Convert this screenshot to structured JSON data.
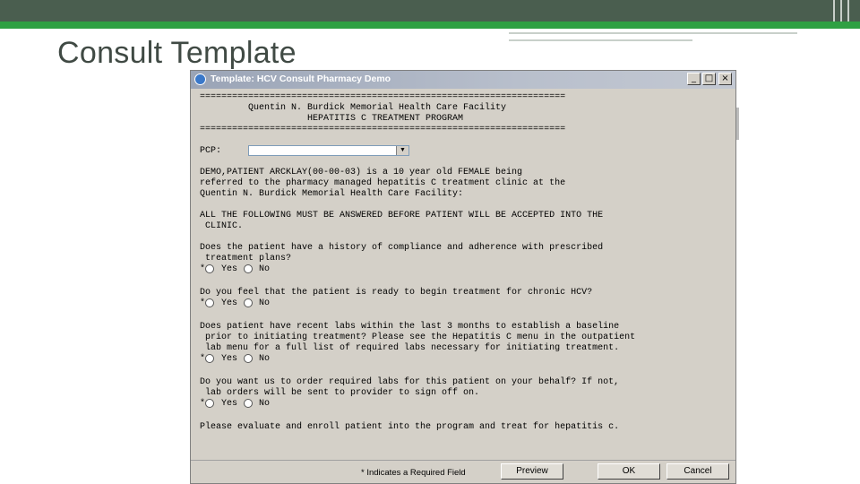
{
  "slide": {
    "title": "Consult Template"
  },
  "window": {
    "title": "Template: HCV Consult Pharmacy Demo",
    "controls": {
      "minimize": "_",
      "maximize": "□",
      "close": "×"
    }
  },
  "form": {
    "rule": "====================================================================",
    "facility": "Quentin N. Burdick Memorial Health Care Facility",
    "program": "HEPATITIS C TREATMENT PROGRAM",
    "pcp_label": "PCP:",
    "pcp_value": "",
    "pcp_arrow": "▼",
    "intro_lines": [
      "DEMO,PATIENT ARCKLAY(00-00-03) is a 10 year old FEMALE being",
      "referred to the pharmacy managed hepatitis C treatment clinic at the",
      "Quentin N. Burdick Memorial Health Care Facility:"
    ],
    "notice_lines": [
      "ALL THE FOLLOWING MUST BE ANSWERED BEFORE PATIENT WILL BE ACCEPTED INTO THE",
      " CLINIC."
    ],
    "questions": [
      {
        "lines": [
          "Does the patient have a history of compliance and adherence with prescribed",
          " treatment plans?"
        ]
      },
      {
        "lines": [
          "Do you feel that the patient is ready to begin treatment for chronic HCV?"
        ]
      },
      {
        "lines": [
          "Does patient have recent labs within the last 3 months to establish a baseline",
          " prior to initiating treatment? Please see the Hepatitis C menu in the outpatient",
          " lab menu for a full list of required labs necessary for initiating treatment."
        ]
      },
      {
        "lines": [
          "Do you want us to order required labs for this patient on your behalf? If not,",
          " lab orders will be sent to provider to sign off on."
        ]
      }
    ],
    "required_mark": "*",
    "yes_label": "Yes",
    "no_label": "No",
    "closing": "Please evaluate and enroll patient into the program and treat for hepatitis c."
  },
  "footer": {
    "required_note": "* Indicates a Required Field",
    "preview": "Preview",
    "ok": "OK",
    "cancel": "Cancel"
  }
}
